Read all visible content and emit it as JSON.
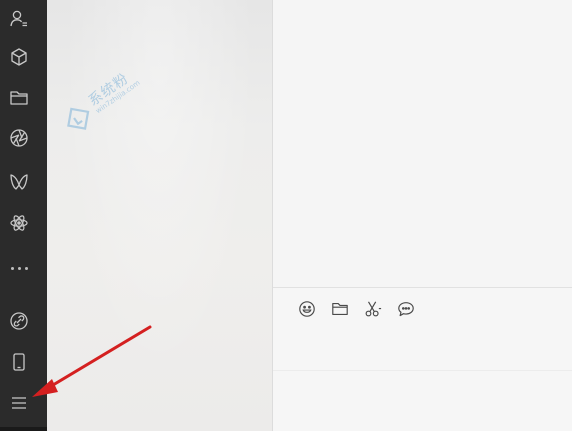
{
  "sidebar": {
    "items": [
      {
        "name": "contacts",
        "icon": "contacts-icon"
      },
      {
        "name": "mini-programs",
        "icon": "cube-icon"
      },
      {
        "name": "files",
        "icon": "folder-icon"
      },
      {
        "name": "moments",
        "icon": "aperture-icon"
      },
      {
        "name": "channels",
        "icon": "butterfly-icon"
      },
      {
        "name": "search",
        "icon": "atom-icon"
      },
      {
        "name": "more",
        "icon": "more-dots-icon"
      }
    ],
    "bottom_items": [
      {
        "name": "mini-program-panel",
        "icon": "link-circle-icon"
      },
      {
        "name": "phone",
        "icon": "phone-icon"
      },
      {
        "name": "settings-menu",
        "icon": "hamburger-menu-icon"
      }
    ]
  },
  "watermark": {
    "text": "系统粉",
    "sub": "win7zhijia.com"
  },
  "toolbar": {
    "buttons": [
      {
        "name": "emoji",
        "icon": "smiley-icon"
      },
      {
        "name": "file",
        "icon": "folder-icon"
      },
      {
        "name": "screenshot",
        "icon": "scissors-icon"
      },
      {
        "name": "chat-history",
        "icon": "chat-bubble-icon"
      }
    ]
  },
  "annotation": {
    "color": "#d42020",
    "target": "hamburger-menu-icon"
  },
  "colors": {
    "sidebar_bg": "#2b2b2b",
    "icon": "#bdbdbd",
    "main_bg": "#f5f5f5"
  }
}
